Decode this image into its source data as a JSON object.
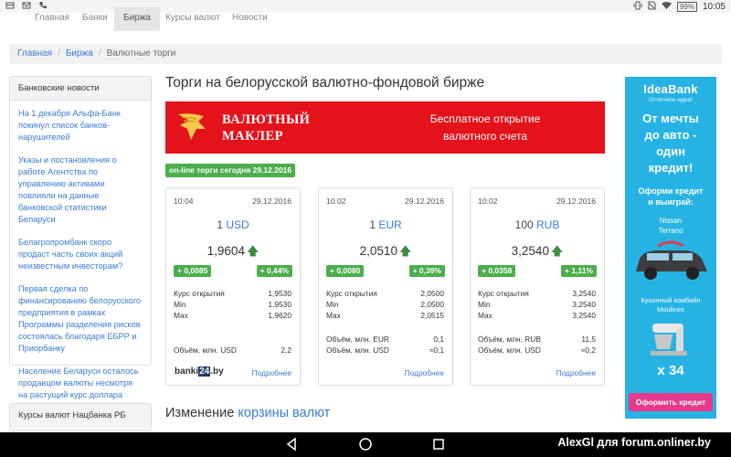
{
  "statusbar": {
    "battery": "99%",
    "time": "10:05"
  },
  "nav": {
    "items": [
      "Главная",
      "Банки",
      "Биржа",
      "Курсы валют",
      "Новости"
    ]
  },
  "breadcrumb": {
    "home": "Главная",
    "section": "Биржа",
    "current": "Валютные торги"
  },
  "sidebar": {
    "news_title": "Банковские новости",
    "news": [
      "На 1 декабря Альфа-Банк покинул список банков-нарушителей",
      "Указы и постановления о работе Агентства по управлению активами повлияли на данные банковской статистики Беларуси",
      "Белагропромбанк скоро продаст часть своих акций неизвестным инвесторам?",
      "Первая сделка по финансированию белорусского предприятия в рамках Программы разделения рисков состоялась благодаря ЕБРР и Приорбанку",
      "Население Беларуси осталось продавцом валюты несмотря на растущий курс доллара"
    ],
    "rates_title": "Курсы валют Нацбанка РБ"
  },
  "main": {
    "title": "Торги на белорусской валютно-фондовой бирже",
    "banner": {
      "brand_line1": "ВАЛЮТНЫЙ",
      "brand_line2": "МАКЛЕР",
      "cta_line1": "Бесплатное открытие",
      "cta_line2": "валютного счета"
    },
    "online_badge": "on-line торги сегодня 29.12.2016",
    "section_title_plain": "Изменение ",
    "section_title_link": "корзины валют"
  },
  "cards": [
    {
      "time": "10:04",
      "date": "29.12.2016",
      "amount": "1",
      "currency": "USD",
      "rate": "1,9604",
      "change_abs": "+ 0,0085",
      "change_pct": "+ 0,44%",
      "open_label": "Курс открытия",
      "open": "1,9530",
      "min_label": "Min",
      "min": "1,9530",
      "max_label": "Max",
      "max": "1,9620",
      "vol1_label": "Объём, млн. USD",
      "vol1": "2,2",
      "vol2_label": "",
      "vol2": "",
      "logo_text": "banki",
      "logo_num": "24",
      "logo_tld": ".by",
      "more": "Подробнее"
    },
    {
      "time": "10:02",
      "date": "29.12.2016",
      "amount": "1",
      "currency": "EUR",
      "rate": "2,0510",
      "change_abs": "+ 0,0080",
      "change_pct": "+ 0,39%",
      "open_label": "Курс открытия",
      "open": "2,0500",
      "min_label": "Min",
      "min": "2,0500",
      "max_label": "Max",
      "max": "2,0515",
      "vol1_label": "Объём, млн. EUR",
      "vol1": "0,1",
      "vol2_label": "Объём, млн. USD",
      "vol2": "≈0,1",
      "more": "Подробнее"
    },
    {
      "time": "10:02",
      "date": "29.12.2016",
      "amount": "100",
      "currency": "RUB",
      "rate": "3,2540",
      "change_abs": "+ 0,0358",
      "change_pct": "+ 1,11%",
      "open_label": "Курс открытия",
      "open": "3,2540",
      "min_label": "Min",
      "min": "3,2540",
      "max_label": "Max",
      "max": "3,2540",
      "vol1_label": "Объём, млн. RUB",
      "vol1": "11,5",
      "vol2_label": "Объём, млн. USD",
      "vol2": "≈0,2",
      "more": "Подробнее"
    }
  ],
  "ad": {
    "brand": "IdeaBank",
    "slogan": "Отличное идея!",
    "headline": [
      "От мечты",
      "до авто -",
      "один",
      "кредит!"
    ],
    "win": [
      "Оформи кредит",
      "и выиграй:"
    ],
    "car": [
      "Nissan",
      "Terrano"
    ],
    "combine": [
      "Кухонный комбайн",
      "Moulinex"
    ],
    "multiplier": "x 34",
    "button": "Оформить кредит"
  },
  "watermark": "AlexGl для forum.onliner.by",
  "colors": {
    "accent_link": "#3a7bd5",
    "positive_badge": "#4cae4c",
    "banner_red": "#e3121b",
    "ad_blue": "#26b3e3",
    "ad_pink": "#e6398b"
  }
}
